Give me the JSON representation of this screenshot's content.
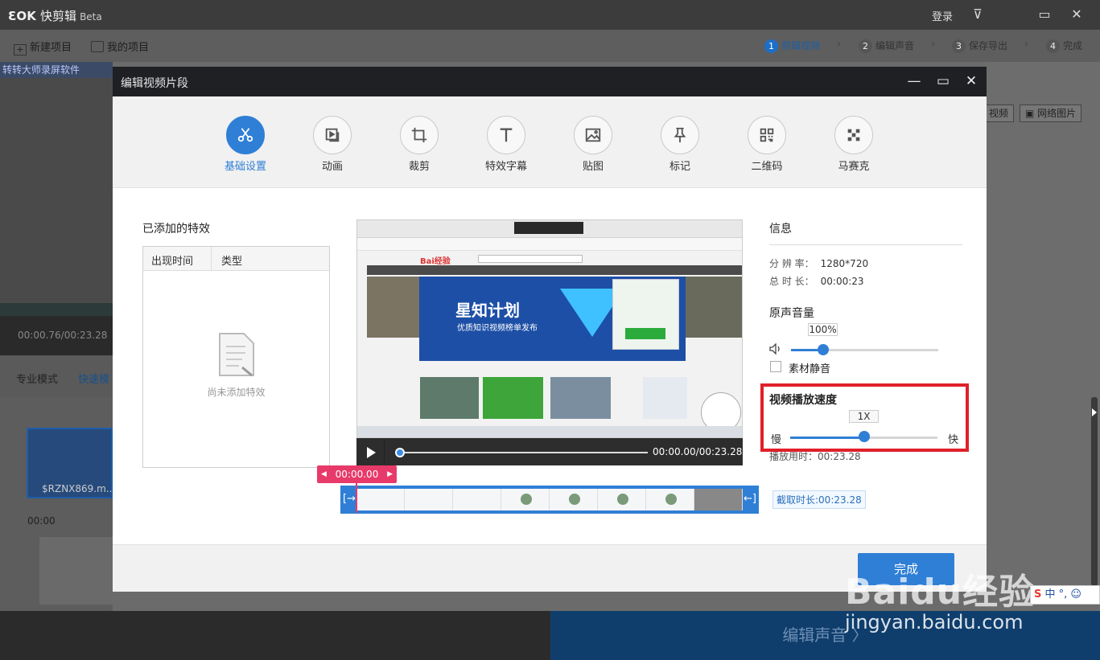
{
  "app": {
    "title": "快剪辑",
    "logo_prefix": "",
    "beta": "Beta",
    "login": "登录",
    "toolbar": {
      "new_project": "新建项目",
      "my_projects": "我的项目"
    },
    "steps": [
      {
        "num": "1",
        "label": "剪辑视频",
        "active": true
      },
      {
        "num": "2",
        "label": "编辑声音",
        "active": false
      },
      {
        "num": "3",
        "label": "保存导出",
        "active": false
      },
      {
        "num": "4",
        "label": "完成",
        "active": false
      }
    ],
    "left_preview_title": "转转大师录屏软件",
    "left_time": "00:00.76/00:23.28",
    "mode_pro": "专业模式",
    "mode_fast": "快速模",
    "clip_name": "$RZNX869.m...",
    "timeline_zero": "00:00",
    "right_buttons": {
      "video": "视频",
      "web_image": "网络图片"
    },
    "bottom_next": "编辑声音 〉"
  },
  "dialog": {
    "title": "编辑视频片段",
    "tabs": [
      {
        "label": "基础设置",
        "icon": "scissors-icon",
        "active": true
      },
      {
        "label": "动画",
        "icon": "animation-icon",
        "active": false
      },
      {
        "label": "裁剪",
        "icon": "crop-icon",
        "active": false
      },
      {
        "label": "特效字幕",
        "icon": "text-icon",
        "active": false
      },
      {
        "label": "贴图",
        "icon": "sticker-icon",
        "active": false
      },
      {
        "label": "标记",
        "icon": "pin-icon",
        "active": false
      },
      {
        "label": "二维码",
        "icon": "qrcode-icon",
        "active": false
      },
      {
        "label": "马赛克",
        "icon": "mosaic-icon",
        "active": false
      }
    ],
    "effects": {
      "title": "已添加的特效",
      "col_time": "出现时间",
      "col_type": "类型",
      "empty": "尚未添加特效"
    },
    "preview": {
      "banner_title": "星知计划",
      "banner_sub": "优质知识视频榜单发布",
      "site": "Bai经验",
      "time": "00:00.00/00:23.28"
    },
    "timecode": "00:00.00",
    "clip_duration": "截取时长:00:23.28",
    "info": {
      "title": "信息",
      "resolution_label": "分 辨 率：",
      "resolution": "1280*720",
      "duration_label": "总 时 长：",
      "duration": "00:00:23"
    },
    "volume": {
      "title": "原声音量",
      "value": "100%",
      "level": 0.22,
      "mute_label": "素材静音",
      "muted": false
    },
    "speed": {
      "title": "视频播放速度",
      "value": "1X",
      "level": 0.5,
      "slow": "慢",
      "fast": "快",
      "play_duration": "播放用时：00:23.28"
    },
    "done": "完成"
  },
  "watermark": {
    "big": "Baidu经验",
    "small": "jingyan.baidu.com"
  },
  "ime": {
    "s": "S",
    "text": "中 °, ☺"
  },
  "colors": {
    "accent": "#2f7fd6",
    "highlight": "#e0202a",
    "timecode": "#e83a6a"
  }
}
